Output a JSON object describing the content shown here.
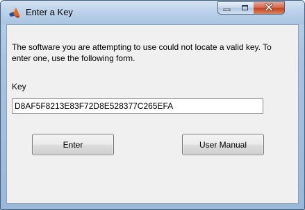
{
  "window": {
    "title": "Enter a Key",
    "app_icon": "matlab-logo-icon",
    "controls": {
      "minimize_icon": "minimize-icon",
      "maximize_icon": "maximize-icon",
      "close_icon": "close-icon"
    }
  },
  "dialog": {
    "message": "The software you are attempting to use could not locate a valid key.  To enter one, use the following form.",
    "key_label": "Key",
    "key_value": "D8AF5F8213E83F72D8E528377C265EFA",
    "enter_label": "Enter",
    "user_manual_label": "User Manual"
  },
  "colors": {
    "close_button": "#c7482a",
    "client_background": "#f0f0f0",
    "frame": "#a9c4e0"
  }
}
